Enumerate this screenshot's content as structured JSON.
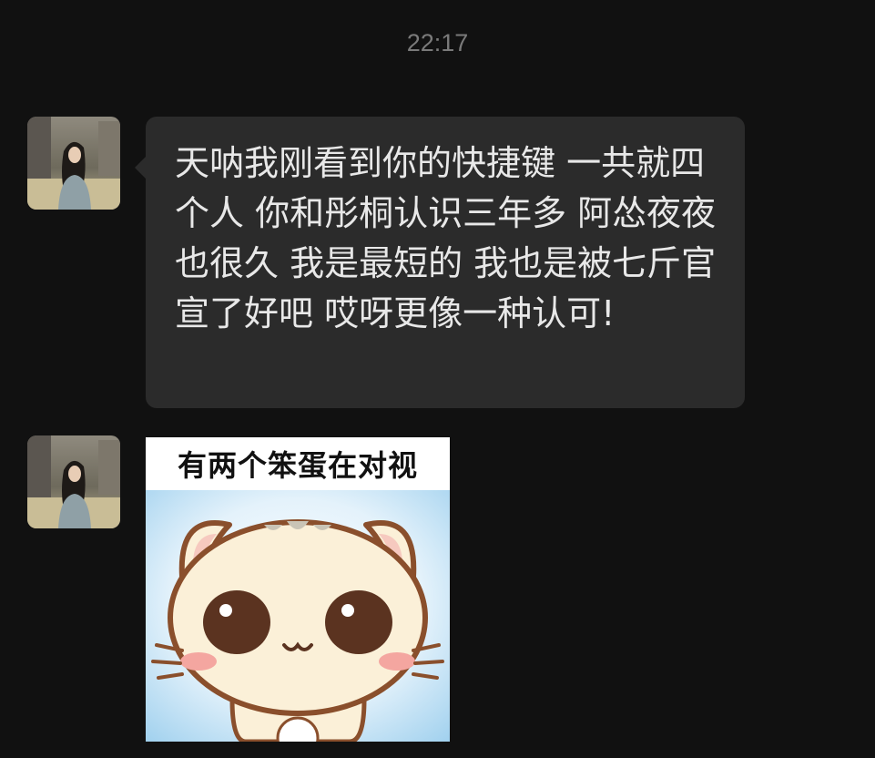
{
  "chat": {
    "timestamp": "22:17",
    "messages": [
      {
        "type": "text",
        "text": "天呐我刚看到你的快捷键 一共就四个人 你和彤桐认识三年多 阿怂夜夜也很久 我是最短的 我也是被七斤官宣了好吧 哎呀更像一种认可!"
      },
      {
        "type": "sticker",
        "caption": "有两个笨蛋在对视",
        "icon": "cute-cat-sticker"
      }
    ]
  },
  "colors": {
    "background": "#111111",
    "bubble": "#2b2b2b",
    "text": "#e8e8e8",
    "timestamp": "#7a7a7a"
  }
}
